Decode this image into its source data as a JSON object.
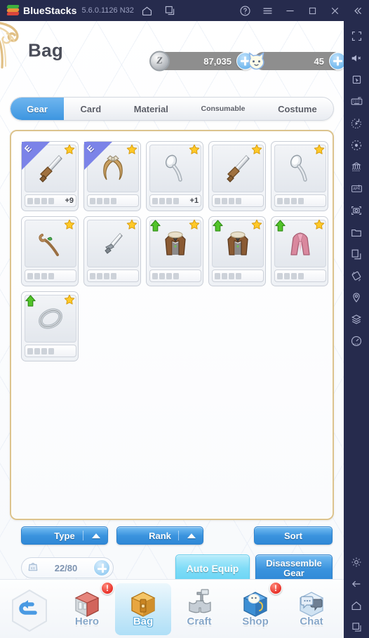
{
  "titlebar": {
    "app_name": "BlueStacks",
    "version": "5.6.0.1126 N32",
    "icons": [
      "home-icon",
      "multi-instance-icon",
      "help-icon",
      "menu-icon",
      "minimize-icon",
      "maximize-icon",
      "close-icon",
      "collapse-icon"
    ]
  },
  "sidebar": {
    "items": [
      {
        "name": "fullscreen-icon"
      },
      {
        "name": "mute-icon"
      },
      {
        "name": "cursor-icon"
      },
      {
        "name": "keyboard-controls-icon"
      },
      {
        "name": "macro-play-icon"
      },
      {
        "name": "record-icon"
      },
      {
        "name": "multi-instance-manager-icon"
      },
      {
        "name": "install-apk-icon"
      },
      {
        "name": "screenshot-icon"
      },
      {
        "name": "media-folder-icon"
      },
      {
        "name": "copy-paste-icon"
      },
      {
        "name": "rotate-icon"
      },
      {
        "name": "location-icon"
      },
      {
        "name": "layers-icon"
      },
      {
        "name": "performance-icon"
      }
    ],
    "bottom_items": [
      {
        "name": "settings-gear-icon"
      },
      {
        "name": "android-back-icon"
      },
      {
        "name": "android-home-icon"
      },
      {
        "name": "android-recents-icon"
      }
    ]
  },
  "header": {
    "title": "Bag",
    "gold": {
      "icon": "zeny-coin-icon",
      "value": "87,035",
      "add": "+"
    },
    "gem": {
      "icon": "cat-token-icon",
      "value": "45",
      "add": "+"
    }
  },
  "tabs": [
    {
      "label": "Gear",
      "active": true
    },
    {
      "label": "Card",
      "active": false
    },
    {
      "label": "Material",
      "active": false
    },
    {
      "label": "Consumable",
      "active": false,
      "small": true
    },
    {
      "label": "Costume",
      "active": false
    }
  ],
  "bag": {
    "slots": [
      {
        "item": "sword-icon",
        "equipped": "E",
        "star": true,
        "upgrade": false,
        "pips": 4,
        "enhance": "+9"
      },
      {
        "item": "headband-icon",
        "equipped": "E",
        "star": true,
        "upgrade": false,
        "pips": 4,
        "enhance": ""
      },
      {
        "item": "spoon-icon",
        "equipped": "",
        "star": true,
        "upgrade": false,
        "pips": 4,
        "enhance": "+1"
      },
      {
        "item": "sword-icon",
        "equipped": "",
        "star": true,
        "upgrade": false,
        "pips": 4,
        "enhance": ""
      },
      {
        "item": "spoon-icon",
        "equipped": "",
        "star": true,
        "upgrade": false,
        "pips": 4,
        "enhance": ""
      },
      {
        "item": "wooden-staff-icon",
        "equipped": "",
        "star": true,
        "upgrade": false,
        "pips": 4,
        "enhance": ""
      },
      {
        "item": "dagger-icon",
        "equipped": "",
        "star": true,
        "upgrade": false,
        "pips": 4,
        "enhance": ""
      },
      {
        "item": "fur-coat-icon",
        "equipped": "",
        "star": true,
        "upgrade": true,
        "pips": 4,
        "enhance": ""
      },
      {
        "item": "fur-coat-icon",
        "equipped": "",
        "star": true,
        "upgrade": true,
        "pips": 4,
        "enhance": ""
      },
      {
        "item": "pink-robe-icon",
        "equipped": "",
        "star": true,
        "upgrade": true,
        "pips": 4,
        "enhance": ""
      },
      {
        "item": "ring-icon",
        "equipped": "",
        "star": true,
        "upgrade": true,
        "pips": 4,
        "enhance": ""
      }
    ]
  },
  "controls": {
    "type_label": "Type",
    "rank_label": "Rank",
    "sort_label": "Sort",
    "auto_equip_label": "Auto Equip",
    "disassemble_label": "Disassemble Gear",
    "capacity": {
      "icon": "weight-kg-icon",
      "value": "22/80",
      "add": "+"
    }
  },
  "bottom_nav": {
    "back_label": "back-button",
    "items": [
      {
        "label": "Hero",
        "icon": "hero-icon",
        "badge": "!",
        "active": false
      },
      {
        "label": "Bag",
        "icon": "bag-icon",
        "badge": "",
        "active": true
      },
      {
        "label": "Craft",
        "icon": "craft-icon",
        "badge": "",
        "active": false
      },
      {
        "label": "Shop",
        "icon": "shop-icon",
        "badge": "!",
        "active": false
      },
      {
        "label": "Chat",
        "icon": "chat-icon",
        "badge": "",
        "active": false
      }
    ]
  },
  "colors": {
    "bs_chrome": "#262b4d",
    "accent_blue": "#3a93de",
    "light_blue": "#7fdcf7",
    "panel_border": "#dcc38d",
    "ribbon": "#7b83e8",
    "star": "#ffc928",
    "upgrade_green": "#53c42a",
    "badge_red": "#e8322a"
  }
}
